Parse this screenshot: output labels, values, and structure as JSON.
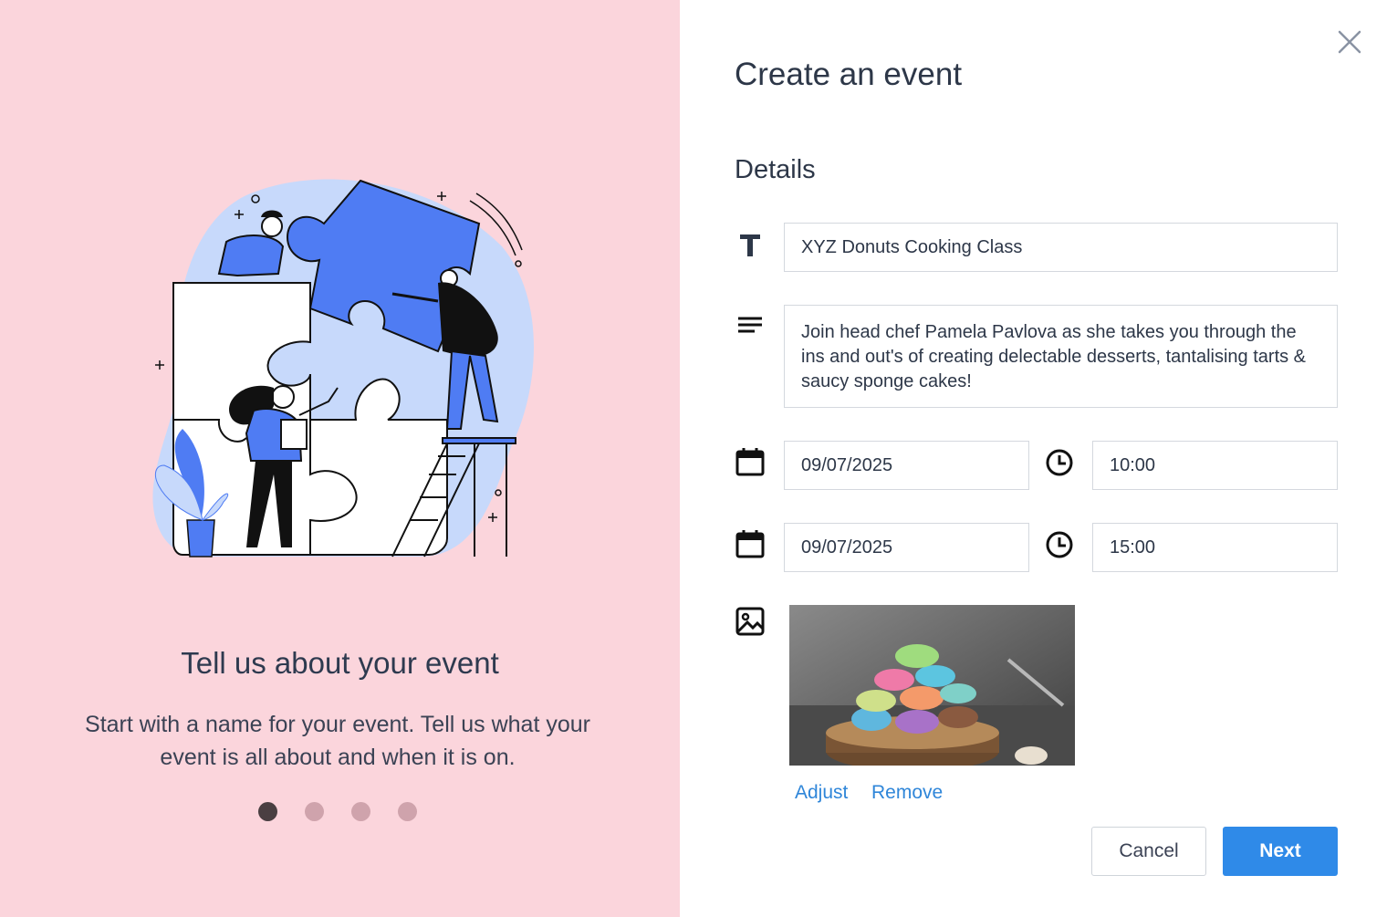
{
  "left": {
    "title": "Tell us about your event",
    "description": "Start with a name for your event. Tell us what your event is all about and when it is on.",
    "step_dots": {
      "count": 4,
      "active": 1
    }
  },
  "dialog": {
    "title": "Create an event",
    "section": "Details",
    "event_name": "XYZ Donuts Cooking Class",
    "description": "Join head chef Pamela Pavlova as she takes you through the ins and out's of creating delectable desserts, tantalising tarts & saucy sponge cakes!",
    "start_date": "09/07/2025",
    "start_time": "10:00",
    "end_date": "09/07/2025",
    "end_time": "15:00",
    "image_actions": {
      "adjust": "Adjust",
      "remove": "Remove"
    },
    "buttons": {
      "cancel": "Cancel",
      "next": "Next"
    }
  },
  "colors": {
    "left_bg": "#fbd5dc",
    "accent": "#2f8ae8",
    "link": "#2f86d9",
    "illustration_blue": "#4f7cf3",
    "illustration_light": "#c7d9fb"
  },
  "icons": [
    "close-icon",
    "text-icon",
    "description-icon",
    "calendar-icon",
    "clock-icon",
    "image-icon"
  ]
}
